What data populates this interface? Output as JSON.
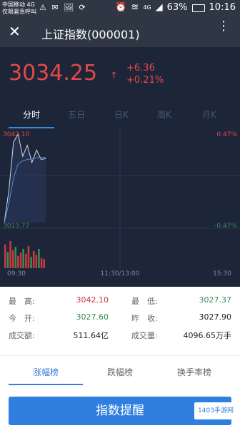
{
  "status_bar": {
    "carrier_line1": "中国移动 4G",
    "carrier_line2": "仅限紧急呼叫",
    "left_icons": "⚠ ✉ 🖼 ⟳",
    "signal": "4G",
    "battery": "63%",
    "time": "10:16"
  },
  "header": {
    "close_icon": "✕",
    "title": "上证指数(000001)",
    "more_icon": "⋮"
  },
  "quote": {
    "price": "3034.25",
    "arrow": "↑",
    "change": "+6.36",
    "change_pct": "+0.21%"
  },
  "chart_tabs": [
    {
      "label": "分时"
    },
    {
      "label": "五日"
    },
    {
      "label": "日K"
    },
    {
      "label": "周K"
    },
    {
      "label": "月K"
    }
  ],
  "chart_labels": {
    "top_left": "3042.10",
    "top_right": "0.47%",
    "bottom_left": "3013.77",
    "bottom_right": "-0.47%",
    "time_start": "09:30",
    "time_mid": "11:30/13:00",
    "time_end": "15:30"
  },
  "colors": {
    "dark_bg": "#1d2538",
    "header_bg": "#2f3745",
    "red": "#e14a4a",
    "green": "#3a8a57",
    "accent_blue": "#2f7fe0"
  },
  "chart_data": {
    "type": "line",
    "x": [
      "09:30",
      "09:35",
      "09:40",
      "09:45",
      "09:50",
      "09:55",
      "10:00",
      "10:05",
      "10:10",
      "10:16"
    ],
    "series": [
      {
        "values": [
          3013.77,
          3024.0,
          3039.5,
          3042.1,
          3035.0,
          3038.5,
          3033.0,
          3037.0,
          3034.0,
          3034.25
        ]
      },
      {
        "values": [
          3013.77,
          3020.0,
          3028.0,
          3032.5,
          3033.5,
          3034.0,
          3034.2,
          3034.5,
          3034.6,
          3034.7
        ]
      }
    ],
    "ylim": [
      3013.77,
      3042.1
    ],
    "volume": [
      58,
      40,
      66,
      44,
      52,
      30,
      38,
      47,
      35,
      54,
      28,
      42,
      33,
      47,
      25,
      22
    ]
  },
  "stats": {
    "high_label": "最　高:",
    "high_value": "3042.10",
    "low_label": "最　低:",
    "low_value": "3027.37",
    "open_label": "今　开:",
    "open_value": "3027.60",
    "prev_close_label": "昨　收:",
    "prev_close_value": "3027.90",
    "turnover_label": "成交额:",
    "turnover_value": "511.64亿",
    "volume_label": "成交量:",
    "volume_value": "4096.65万手"
  },
  "rank_tabs": [
    {
      "label": "涨幅榜"
    },
    {
      "label": "跌幅榜"
    },
    {
      "label": "换手率榜"
    }
  ],
  "remind_button": "指数提醒",
  "watermark": "1403手游网"
}
